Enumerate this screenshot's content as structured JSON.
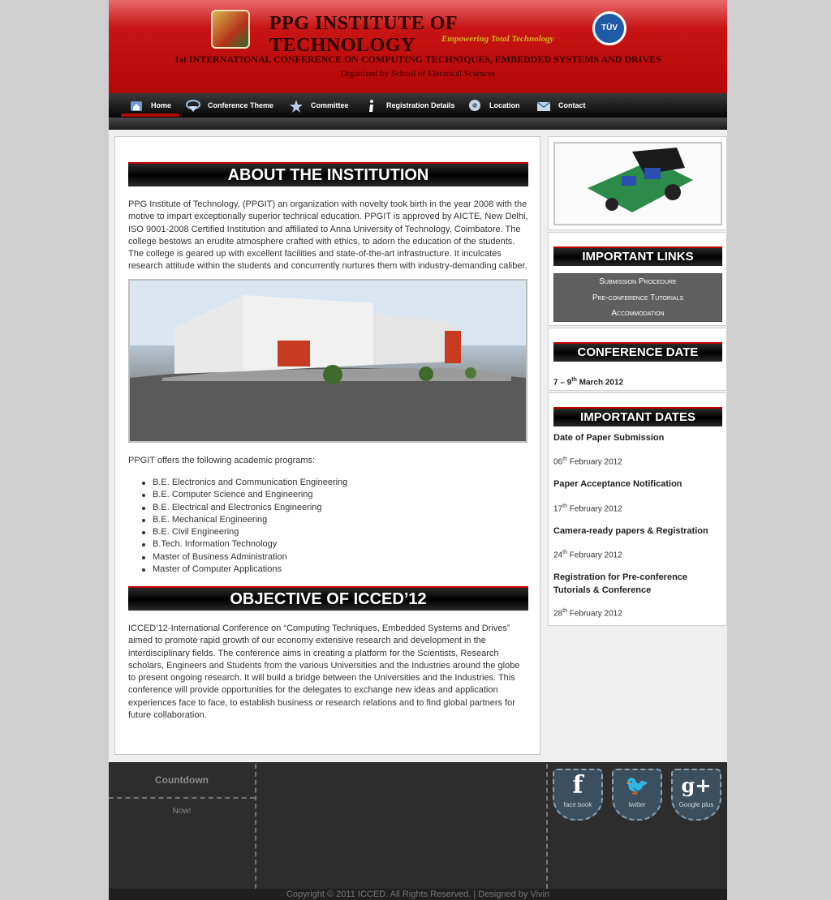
{
  "header": {
    "title": "PPG INSTITUTE OF TECHNOLOGY",
    "tagline": "Empowering Total Technology",
    "conference_title": "1st INTERNATIONAL CONFERENCE ON COMPUTING TECHNIQUES, EMBEDDED SYSTEMS AND DRIVES",
    "organized_by": "Organized by School of Electrical Sciences",
    "certification_badge": "TÜV"
  },
  "nav": {
    "items": [
      {
        "label": "Home",
        "icon": "home-icon"
      },
      {
        "label": "Conference Theme",
        "icon": "globe-icon"
      },
      {
        "label": "Committee",
        "icon": "star-icon"
      },
      {
        "label": "Registration Details",
        "icon": "info-icon"
      },
      {
        "label": "Location",
        "icon": "map-pin-icon"
      },
      {
        "label": "Contact",
        "icon": "mail-icon"
      }
    ],
    "active": "Home"
  },
  "main": {
    "about_heading": "ABOUT THE INSTITUTION",
    "about_text": "PPG Institute of Technology, (PPGIT) an organization with novelty took birth in the year 2008 with the motive to impart exceptionally superior technical education. PPGIT is approved by AICTE, New Delhi, ISO 9001-2008 Certified Institution and affiliated to Anna University of Technology, Coimbatore. The college bestows an erudite atmosphere crafted with ethics, to adorn the education of the students. The college is geared up with excellent facilities and state-of-the-art infrastructure. It inculcates research attitude within the students and concurrently nurtures them with industry-demanding caliber.",
    "programs_intro": "PPGIT offers the following academic programs:",
    "programs": [
      "B.E. Electronics and Communication Engineering",
      "B.E. Computer Science and Engineering",
      "B.E. Electrical and Electronics Engineering",
      "B.E. Mechanical Engineering",
      "B.E. Civil Engineering",
      "B.Tech. Information Technology",
      "Master of Business Administration",
      "Master of Computer Applications"
    ],
    "objective_heading": "OBJECTIVE OF ICCED’12",
    "objective_text": "ICCED’12-International Conference on “Computing Techniques, Embedded Systems and Drives” aimed to promote rapid growth of our economy extensive research and development in the interdisciplinary fields. The conference aims in creating a platform for the Scientists, Research scholars, Engineers and Students from the various Universities and the Industries around the globe to present ongoing research. It will build a bridge between the Universities and the Industries. This conference will provide opportunities for the delegates to exchange new ideas and application experiences face to face, to establish business or research relations and to find global partners for future collaboration."
  },
  "sidebar": {
    "links_heading": "IMPORTANT LINKS",
    "links": [
      "Submission Procedure",
      "Pre-conference Tutorials",
      "Accommodation"
    ],
    "conf_date_heading": "CONFERENCE DATE",
    "conf_date": {
      "start": "7",
      "dash": " – 9",
      "sup": "th",
      "rest": " March 2012"
    },
    "dates_heading": "IMPORTANT DATES",
    "dates": [
      {
        "title": "Date of Paper Submission",
        "day": "06",
        "sup": "th",
        "rest": " February 2012"
      },
      {
        "title": "Paper Acceptance Notification",
        "day": "17",
        "sup": "th",
        "rest": " February 2012"
      },
      {
        "title": "Camera-ready papers & Registration",
        "day": "24",
        "sup": "th",
        "rest": " February 2012"
      },
      {
        "title": "Registration for Pre-conference Tutorials & Conference",
        "day": "28",
        "sup": "th",
        "rest": " February 2012"
      }
    ]
  },
  "footer": {
    "countdown_label": "Countdown",
    "countdown_value": "Now!",
    "social": [
      {
        "glyph": "f",
        "label": "face book"
      },
      {
        "glyph": "🐦",
        "label": "twitter"
      },
      {
        "glyph": "g+",
        "label": "Google plus"
      }
    ],
    "copyright": "Copyright © 2011 ICCED. All Rights Reserved. | Designed by Vivin"
  }
}
